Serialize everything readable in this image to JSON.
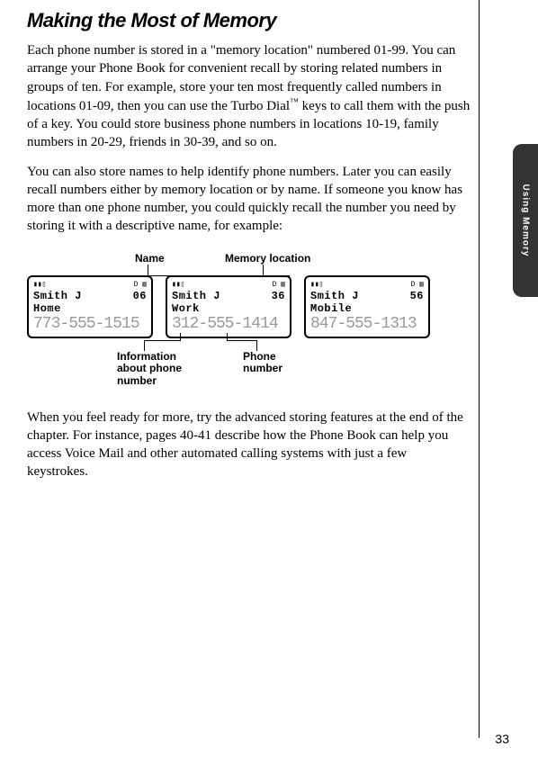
{
  "title": "Making the Most of Memory",
  "sideTab": "Using Memory",
  "paragraphs": {
    "p1_a": "Each phone number is stored in a \"memory location\" numbered 01-99. You can arrange your Phone Book for convenient recall by storing related numbers in groups of ten. For example, store your ten most frequently called numbers in locations 01-09, then you can use the Turbo Dial",
    "p1_tm": "™",
    "p1_b": " keys to call them with the push of a key. You could store business phone numbers in locations 10-19, family numbers in 20-29, friends in 30-39, and so on.",
    "p2": "You can also store names to help identify phone numbers. Later you can easily recall numbers either by memory location or by name. If someone you know has more than one phone number, you could quickly recall the number you need by storing it with a descriptive name, for example:",
    "p3": "When you feel ready for more, try the advanced storing features at the end of the chapter. For instance, pages 40-41 describe how the Phone Book can help you access Voice Mail and other automated calling systems with just a few keystrokes."
  },
  "diagram": {
    "labels": {
      "name": "Name",
      "memoryLocation": "Memory location",
      "information": "Information about phone number",
      "phoneNumber": "Phone number"
    },
    "screens": [
      {
        "name": "Smith J",
        "loc": "06",
        "desc": "Home",
        "number": "773-555-1515"
      },
      {
        "name": "Smith J",
        "loc": "36",
        "desc": "Work",
        "number": "312-555-1414"
      },
      {
        "name": "Smith J",
        "loc": "56",
        "desc": "Mobile",
        "number": "847-555-1313"
      }
    ]
  },
  "pageNumber": "33"
}
